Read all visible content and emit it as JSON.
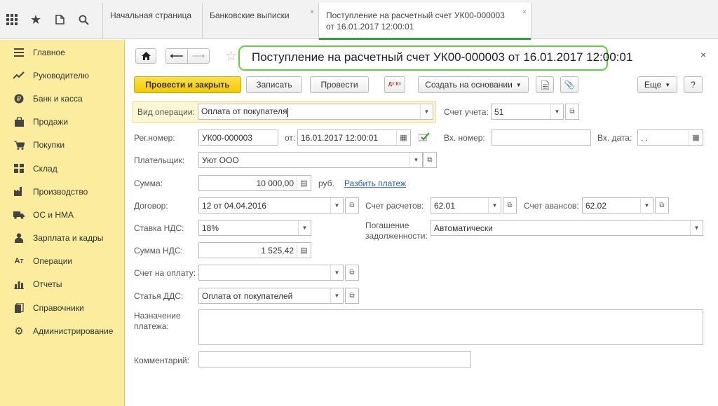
{
  "top_icons": [
    "apps-grid-icon",
    "favorites-star-icon",
    "history-icon",
    "search-icon"
  ],
  "tabs": [
    {
      "label": "Начальная страница"
    },
    {
      "label": "Банковские выписки"
    },
    {
      "label_line1": "Поступление на расчетный счет УК00-000003",
      "label_line2": "от 16.01.2017 12:00:01"
    }
  ],
  "tab_close": "×",
  "sidebar": {
    "items": [
      {
        "label": "Главное",
        "icon": "menu-icon"
      },
      {
        "label": "Руководителю",
        "icon": "trend-icon"
      },
      {
        "label": "Банк и касса",
        "icon": "ruble-icon"
      },
      {
        "label": "Продажи",
        "icon": "bag-icon"
      },
      {
        "label": "Покупки",
        "icon": "cart-icon"
      },
      {
        "label": "Склад",
        "icon": "warehouse-icon"
      },
      {
        "label": "Производство",
        "icon": "factory-icon"
      },
      {
        "label": "ОС и НМА",
        "icon": "truck-icon"
      },
      {
        "label": "Зарплата и кадры",
        "icon": "person-icon"
      },
      {
        "label": "Операции",
        "icon": "operations-icon"
      },
      {
        "label": "Отчеты",
        "icon": "reports-icon"
      },
      {
        "label": "Справочники",
        "icon": "books-icon"
      },
      {
        "label": "Администрирование",
        "icon": "gear-icon"
      }
    ]
  },
  "doc": {
    "title": "Поступление на расчетный счет УК00-000003 от 16.01.2017 12:00:01",
    "close": "×"
  },
  "toolbar": {
    "post_close": "Провести и закрыть",
    "save": "Записать",
    "post": "Провести",
    "dtkt": "Дт Кт",
    "create_based": "Создать на основании",
    "more": "Еще",
    "help": "?"
  },
  "form": {
    "op_type_label": "Вид операции:",
    "op_type_value": "Оплата от покупателя",
    "account_label": "Счет учета:",
    "account_value": "51",
    "reg_label": "Рег.номер:",
    "reg_value": "УК00-000003",
    "from_label": "от:",
    "date_value": "16.01.2017 12:00:01",
    "in_num_label": "Вх. номер:",
    "in_num_value": "",
    "in_date_label": "Вх. дата:",
    "in_date_value": " .  .",
    "payer_label": "Плательщик:",
    "payer_value": "Уют ООО",
    "sum_label": "Сумма:",
    "sum_value": "10 000,00",
    "currency": "руб.",
    "split_link": "Разбить платеж",
    "contract_label": "Договор:",
    "contract_value": "12 от 04.04.2016",
    "settle_label": "Счет расчетов:",
    "settle_value": "62.01",
    "advance_label": "Счет авансов:",
    "advance_value": "62.02",
    "vat_rate_label": "Ставка НДС:",
    "vat_rate_value": "18%",
    "repay_label_1": "Погашение",
    "repay_label_2": "задолженности:",
    "repay_value": "Автоматически",
    "vat_sum_label": "Сумма НДС:",
    "vat_sum_value": "1 525,42",
    "invoice_label": "Счет на оплату:",
    "invoice_value": "",
    "dds_label": "Статья ДДС:",
    "dds_value": "Оплата от покупателей",
    "purpose_label_1": "Назначение",
    "purpose_label_2": "платежа:",
    "purpose_value": "",
    "comment_label": "Комментарий:",
    "comment_value": ""
  }
}
